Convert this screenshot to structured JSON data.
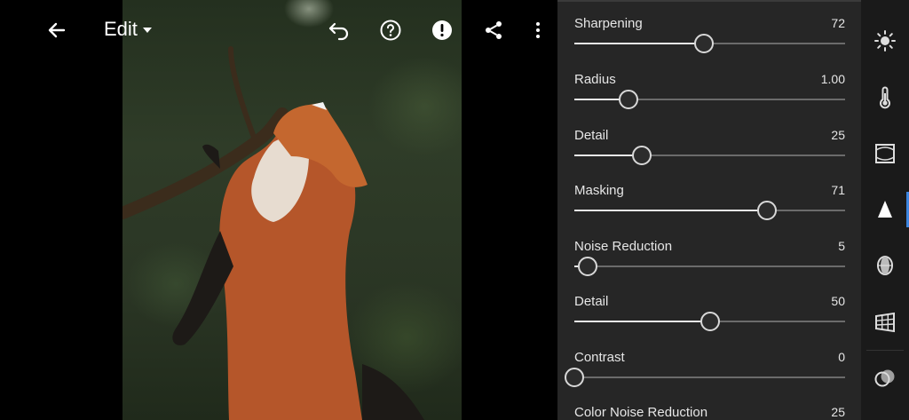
{
  "toolbar": {
    "mode_label": "Edit",
    "icons": [
      "back-arrow-icon",
      "undo-icon",
      "help-icon",
      "alert-icon",
      "share-icon",
      "more-vertical-icon"
    ]
  },
  "photo": {
    "subject": "fox"
  },
  "panel": {
    "sliders": [
      {
        "label": "Sharpening",
        "value": "72",
        "fraction": 0.48
      },
      {
        "label": "Radius",
        "value": "1.00",
        "fraction": 0.2
      },
      {
        "label": "Detail",
        "value": "25",
        "fraction": 0.25
      },
      {
        "label": "Masking",
        "value": "71",
        "fraction": 0.71
      },
      {
        "label": "Noise Reduction",
        "value": "5",
        "fraction": 0.05
      },
      {
        "label": "Detail",
        "value": "50",
        "fraction": 0.5
      },
      {
        "label": "Contrast",
        "value": "0",
        "fraction": 0.0
      },
      {
        "label": "Color Noise Reduction",
        "value": "25",
        "fraction": 0.25
      }
    ]
  },
  "strip": {
    "icons": [
      "light-icon",
      "color-temperature-icon",
      "effects-icon",
      "detail-icon",
      "optics-icon",
      "geometry-icon",
      "presets-icon"
    ],
    "active": "detail-icon",
    "accent": "#3d86e0"
  }
}
